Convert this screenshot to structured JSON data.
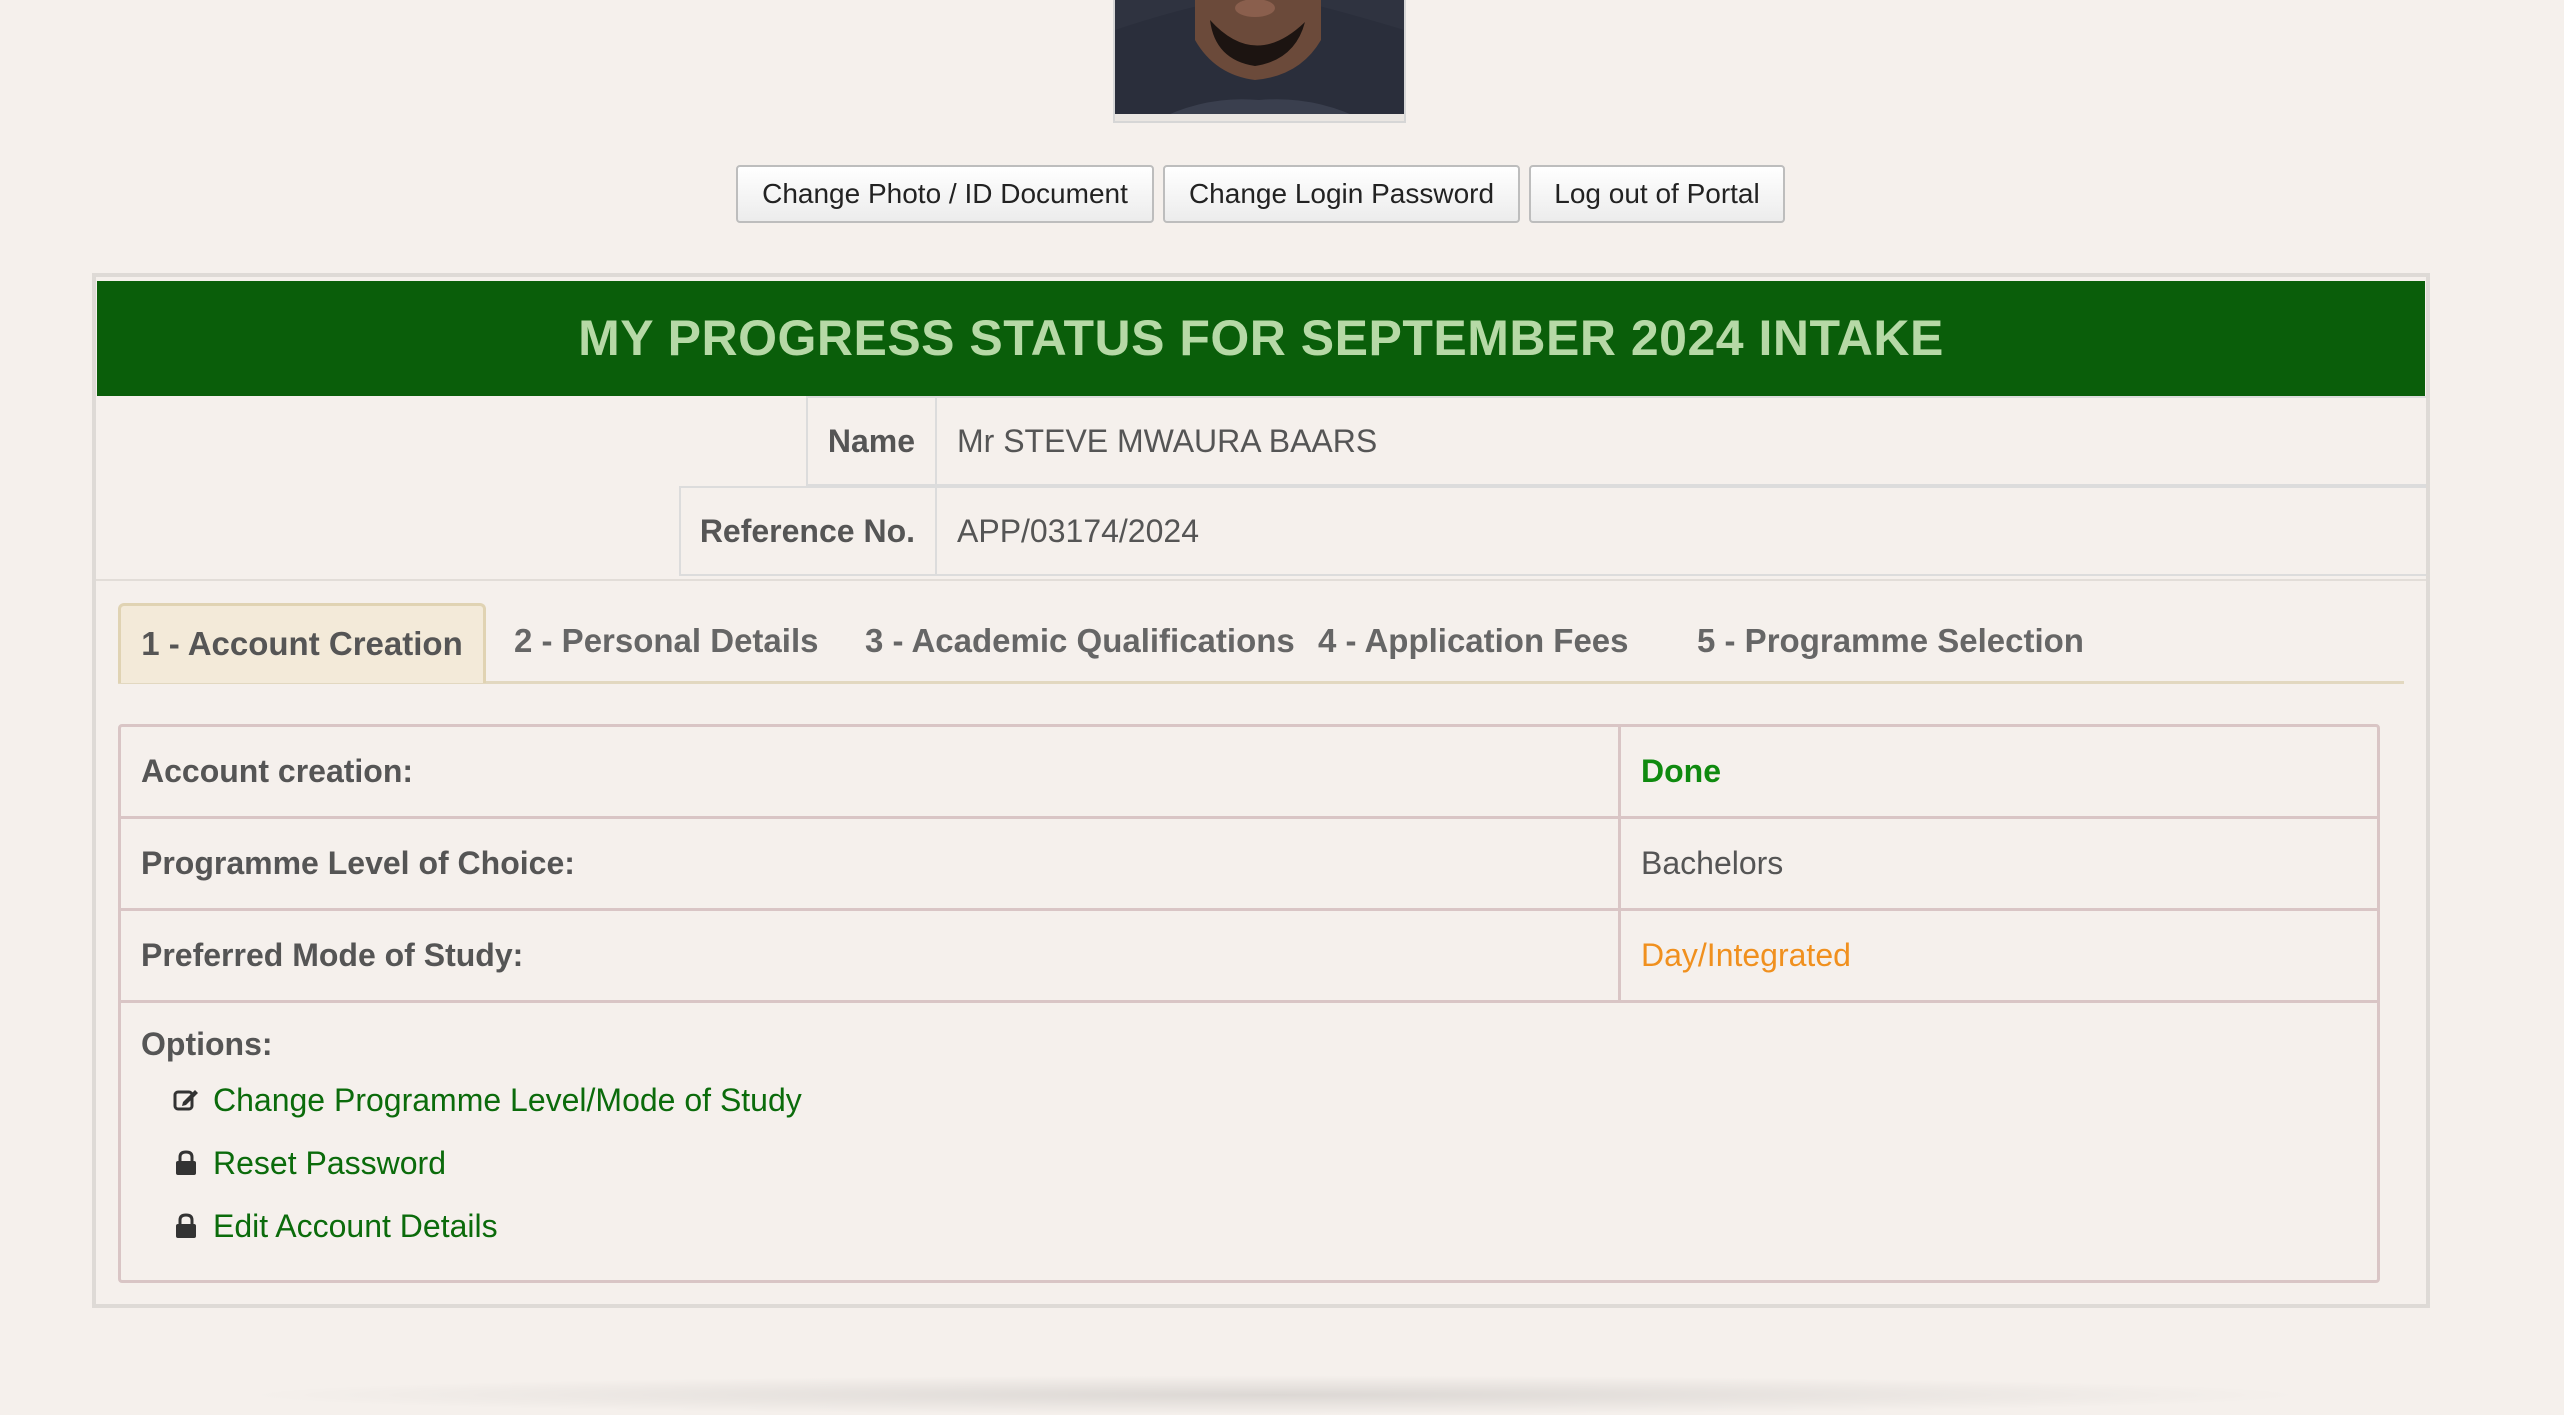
{
  "profile": {
    "photo_alt": "applicant-photo"
  },
  "toolbar": {
    "change_photo_label": "Change Photo / ID Document",
    "change_password_label": "Change Login Password",
    "logout_label": "Log out of Portal"
  },
  "panel": {
    "title": "MY PROGRESS STATUS FOR SEPTEMBER 2024 INTAKE",
    "header_color": "#0a5e0a",
    "title_color": "#b6d9a6"
  },
  "applicant": {
    "name_label": "Name",
    "name_value": "Mr STEVE MWAURA BAARS",
    "ref_label": "Reference No.",
    "ref_value": "APP/03174/2024"
  },
  "tabs": [
    {
      "label": "1 - Account Creation",
      "active": true
    },
    {
      "label": "2 - Personal Details",
      "active": false
    },
    {
      "label": "3 - Academic Qualifications",
      "active": false
    },
    {
      "label": "4 - Application Fees",
      "active": false
    },
    {
      "label": "5 - Programme Selection",
      "active": false
    }
  ],
  "details": {
    "rows": [
      {
        "label": "Account creation:",
        "value": "Done",
        "color": "#0f8a0f"
      },
      {
        "label": "Programme Level of Choice:",
        "value": "Bachelors",
        "color": "#555555"
      },
      {
        "label": "Preferred Mode of Study:",
        "value": "Day/Integrated",
        "color": "#f0901e"
      }
    ],
    "options_title": "Options:",
    "options": [
      {
        "icon": "edit-icon",
        "label": "Change Programme Level/Mode of Study"
      },
      {
        "icon": "lock-icon",
        "label": "Reset Password"
      },
      {
        "icon": "lock-icon",
        "label": "Edit Account Details"
      }
    ],
    "link_color": "#0b6b0b"
  }
}
